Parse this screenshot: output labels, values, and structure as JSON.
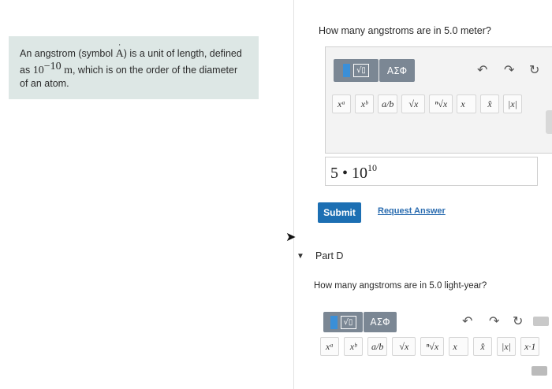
{
  "info": {
    "text_1": "An angstrom (symbol ",
    "symbol": "A",
    "text_2": ") is a unit of length, defined",
    "text_3": "as ",
    "base": "10",
    "exponent": "−10",
    "unit": " m",
    "text_4": ", which is on the order of the diameter",
    "text_5": "of an atom."
  },
  "part_c": {
    "question": "How many angstroms are in 5.0 meter?",
    "answer_base": "5 • 10",
    "answer_exp": "10"
  },
  "toolbar": {
    "template_box": "√▯",
    "greek": "ΑΣΦ",
    "undo": "↶",
    "redo": "↷",
    "reset": "↻",
    "symbols": [
      "xᵃ",
      "xᵇ",
      "a/b",
      "√x",
      "ⁿ√x",
      "x⃗",
      "x̂",
      "|x|"
    ]
  },
  "submit_label": "Submit",
  "request_label": "Request Answer",
  "part_d": {
    "arrow": "▼",
    "label": "Part D",
    "question": "How many angstroms are in 5.0 light-year?",
    "symbols": [
      "xᵃ",
      "xᵇ",
      "a/b",
      "√x",
      "ⁿ√x",
      "x⃗",
      "x̂",
      "|x|",
      "x·1"
    ]
  },
  "colors": {
    "info_bg": "#dde7e5",
    "submit_bg": "#1c6fb3",
    "link": "#2a6cb0",
    "template_btn": "#7b8794"
  }
}
